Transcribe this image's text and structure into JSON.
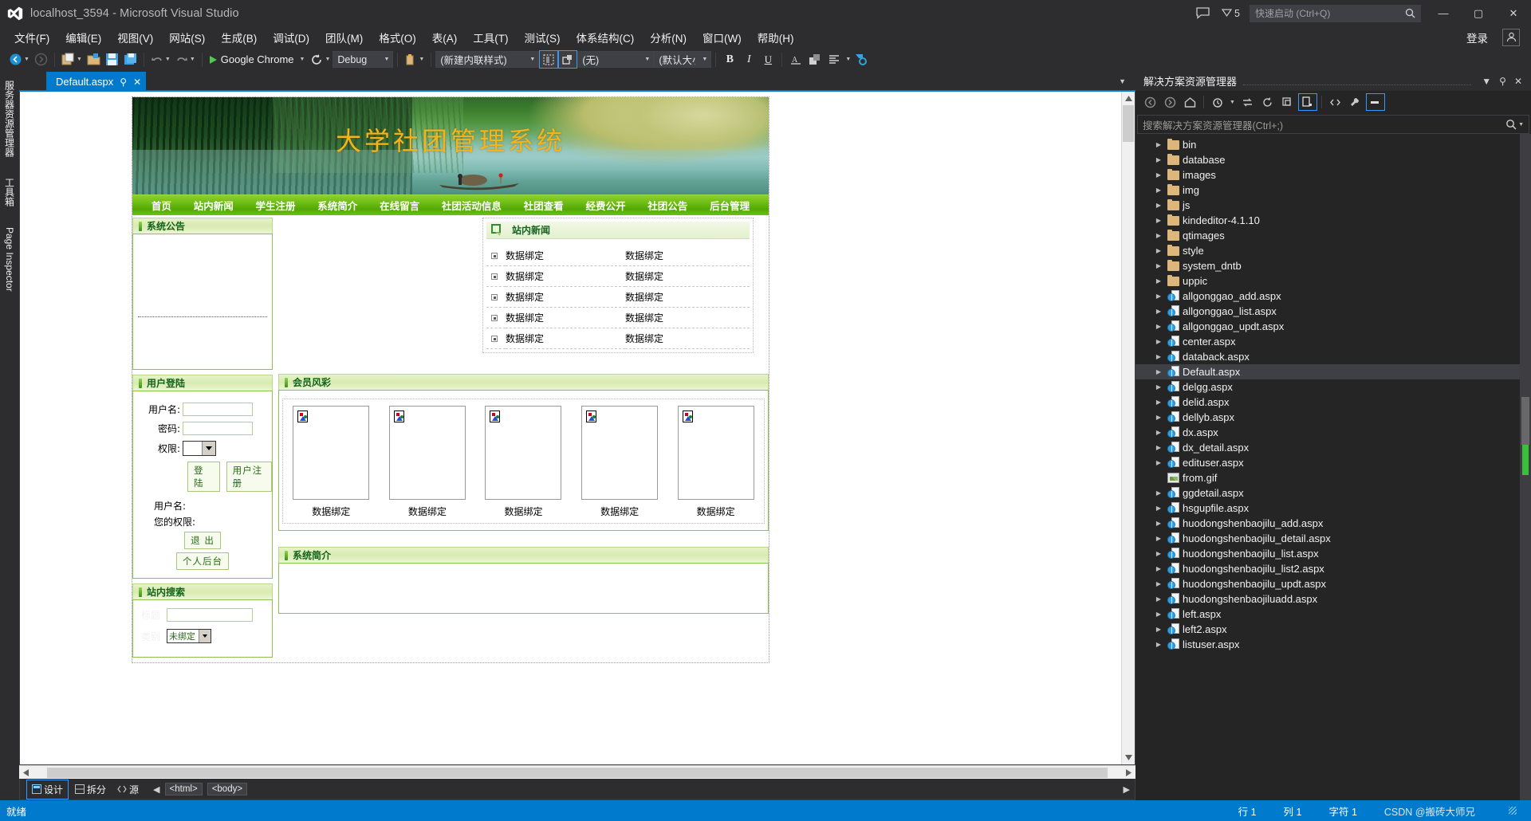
{
  "titlebar": {
    "title": "localhost_3594 - Microsoft Visual Studio",
    "notification_count": "5",
    "quick_launch_placeholder": "快速启动 (Ctrl+Q)",
    "minimize": "—",
    "maximize": "▢",
    "close": "✕"
  },
  "menubar": {
    "items": [
      {
        "label": "文件(F)"
      },
      {
        "label": "编辑(E)"
      },
      {
        "label": "视图(V)"
      },
      {
        "label": "网站(S)"
      },
      {
        "label": "生成(B)"
      },
      {
        "label": "调试(D)"
      },
      {
        "label": "团队(M)"
      },
      {
        "label": "格式(O)"
      },
      {
        "label": "表(A)"
      },
      {
        "label": "工具(T)"
      },
      {
        "label": "测试(S)"
      },
      {
        "label": "体系结构(C)"
      },
      {
        "label": "分析(N)"
      },
      {
        "label": "窗口(W)"
      },
      {
        "label": "帮助(H)"
      }
    ],
    "signin": "登录"
  },
  "toolbar": {
    "run_label": "Google Chrome",
    "config_label": "Debug",
    "style_combo": "(新建内联样式)",
    "target_rule_combo": "(无)",
    "font_size_combo": "(默认大小)",
    "bold": "B",
    "italic": "I",
    "underline": "U"
  },
  "left_strips": {
    "server_explorer": "服务器资源管理器",
    "toolbox": "工具箱",
    "page_inspector": "Page Inspector"
  },
  "editor": {
    "tab_name": "Default.aspx",
    "tab_close": "✕",
    "view_buttons": [
      {
        "label": "设计",
        "active": true
      },
      {
        "label": "拆分",
        "active": false
      },
      {
        "label": "源",
        "active": false
      }
    ],
    "tag_navigator": [
      "<html>",
      "<body>"
    ]
  },
  "webpage": {
    "banner_title": "大学社团管理系统",
    "nav": [
      "首页",
      "站内新闻",
      "学生注册",
      "系统简介",
      "在线留言",
      "社团活动信息",
      "社团查看",
      "经费公开",
      "社团公告",
      "后台管理"
    ],
    "notice_panel": {
      "title": "系统公告"
    },
    "login_panel": {
      "title": "用户登陆",
      "username_label": "用户名:",
      "password_label": "密码:",
      "permission_label": "权限:",
      "username_value": "",
      "password_value": "",
      "permission_value": "",
      "login_button": "登 陆",
      "register_button": "用户注册",
      "status_username_label": "用户名:",
      "status_permission_label": "您的权限:",
      "logout_button": "退 出",
      "personal_button": "个人后台"
    },
    "search_panel": {
      "title": "站内搜索",
      "title_label": "标题",
      "title_value": "",
      "kind_label": "类别",
      "kind_value": "未绑定"
    },
    "news_panel": {
      "title": "站内新闻",
      "rows": [
        {
          "col1": "数据绑定",
          "col2": "数据绑定"
        },
        {
          "col1": "数据绑定",
          "col2": "数据绑定"
        },
        {
          "col1": "数据绑定",
          "col2": "数据绑定"
        },
        {
          "col1": "数据绑定",
          "col2": "数据绑定"
        },
        {
          "col1": "数据绑定",
          "col2": "数据绑定"
        }
      ]
    },
    "gallery_panel": {
      "title": "会员风彩",
      "items": [
        {
          "caption": "数据绑定"
        },
        {
          "caption": "数据绑定"
        },
        {
          "caption": "数据绑定"
        },
        {
          "caption": "数据绑定"
        },
        {
          "caption": "数据绑定"
        }
      ]
    },
    "intro_panel": {
      "title": "系统简介"
    }
  },
  "solution_explorer": {
    "title": "解决方案资源管理器",
    "search_placeholder": "搜索解决方案资源管理器(Ctrl+;)",
    "tree": [
      {
        "name": "bin",
        "type": "folder",
        "expandable": true,
        "selected": false
      },
      {
        "name": "database",
        "type": "folder",
        "expandable": true,
        "selected": false
      },
      {
        "name": "images",
        "type": "folder",
        "expandable": true,
        "selected": false
      },
      {
        "name": "img",
        "type": "folder",
        "expandable": true,
        "selected": false
      },
      {
        "name": "js",
        "type": "folder",
        "expandable": true,
        "selected": false
      },
      {
        "name": "kindeditor-4.1.10",
        "type": "folder",
        "expandable": true,
        "selected": false
      },
      {
        "name": "qtimages",
        "type": "folder",
        "expandable": true,
        "selected": false
      },
      {
        "name": "style",
        "type": "folder",
        "expandable": true,
        "selected": false
      },
      {
        "name": "system_dntb",
        "type": "folder",
        "expandable": true,
        "selected": false
      },
      {
        "name": "uppic",
        "type": "folder",
        "expandable": true,
        "selected": false
      },
      {
        "name": "allgonggao_add.aspx",
        "type": "aspx",
        "expandable": true,
        "selected": false
      },
      {
        "name": "allgonggao_list.aspx",
        "type": "aspx",
        "expandable": true,
        "selected": false
      },
      {
        "name": "allgonggao_updt.aspx",
        "type": "aspx",
        "expandable": true,
        "selected": false
      },
      {
        "name": "center.aspx",
        "type": "aspx",
        "expandable": true,
        "selected": false
      },
      {
        "name": "databack.aspx",
        "type": "aspx",
        "expandable": true,
        "selected": false
      },
      {
        "name": "Default.aspx",
        "type": "aspx",
        "expandable": true,
        "selected": true
      },
      {
        "name": "delgg.aspx",
        "type": "aspx",
        "expandable": true,
        "selected": false
      },
      {
        "name": "delid.aspx",
        "type": "aspx",
        "expandable": true,
        "selected": false
      },
      {
        "name": "dellyb.aspx",
        "type": "aspx",
        "expandable": true,
        "selected": false
      },
      {
        "name": "dx.aspx",
        "type": "aspx",
        "expandable": true,
        "selected": false
      },
      {
        "name": "dx_detail.aspx",
        "type": "aspx",
        "expandable": true,
        "selected": false
      },
      {
        "name": "edituser.aspx",
        "type": "aspx",
        "expandable": true,
        "selected": false
      },
      {
        "name": "from.gif",
        "type": "gif",
        "expandable": false,
        "selected": false
      },
      {
        "name": "ggdetail.aspx",
        "type": "aspx",
        "expandable": true,
        "selected": false
      },
      {
        "name": "hsgupfile.aspx",
        "type": "aspx",
        "expandable": true,
        "selected": false
      },
      {
        "name": "huodongshenbaojilu_add.aspx",
        "type": "aspx",
        "expandable": true,
        "selected": false
      },
      {
        "name": "huodongshenbaojilu_detail.aspx",
        "type": "aspx",
        "expandable": true,
        "selected": false
      },
      {
        "name": "huodongshenbaojilu_list.aspx",
        "type": "aspx",
        "expandable": true,
        "selected": false
      },
      {
        "name": "huodongshenbaojilu_list2.aspx",
        "type": "aspx",
        "expandable": true,
        "selected": false
      },
      {
        "name": "huodongshenbaojilu_updt.aspx",
        "type": "aspx",
        "expandable": true,
        "selected": false
      },
      {
        "name": "huodongshenbaojiluadd.aspx",
        "type": "aspx",
        "expandable": true,
        "selected": false
      },
      {
        "name": "left.aspx",
        "type": "aspx",
        "expandable": true,
        "selected": false
      },
      {
        "name": "left2.aspx",
        "type": "aspx",
        "expandable": true,
        "selected": false
      },
      {
        "name": "listuser.aspx",
        "type": "aspx",
        "expandable": true,
        "selected": false
      }
    ]
  },
  "statusbar": {
    "state": "就绪",
    "line_label": "行 1",
    "col_label": "列 1",
    "char_label": "字符 1",
    "watermark": "CSDN @搬砖大师兄"
  },
  "colors": {
    "accent": "#007acc",
    "titlebar_bg": "#2d2d30",
    "panel_bg": "#252526",
    "nav_green": "#6fbf16",
    "banner_title": "#f2b51c",
    "selection": "#3f3f46"
  }
}
